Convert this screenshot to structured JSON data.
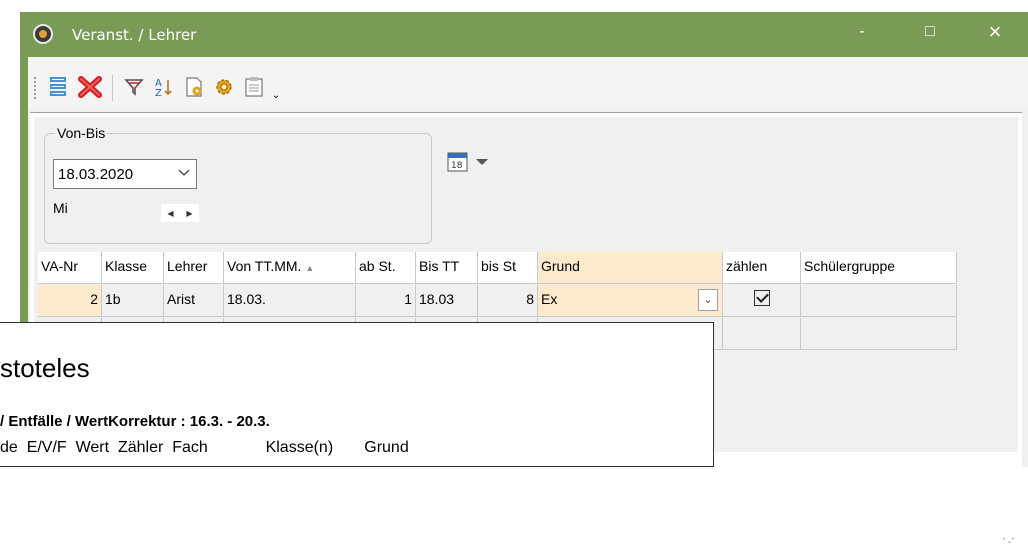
{
  "window": {
    "title": "Veranst. / Lehrer",
    "controls": {
      "minimize": "-",
      "maximize": "□",
      "close": "×"
    }
  },
  "toolbar": {
    "icons": [
      "list-icon",
      "delete-icon",
      "filter-icon",
      "sort-icon",
      "report-icon",
      "settings-icon",
      "clipboard-icon"
    ]
  },
  "filter": {
    "group_label": "Von-Bis",
    "date_value": "18.03.2020",
    "day": "Mi"
  },
  "grid": {
    "headers": [
      "VA-Nr",
      "Klasse",
      "Lehrer",
      "Von TT.MM.",
      "ab St.",
      "Bis TT",
      "bis St",
      "Grund",
      "zählen",
      "Schülergruppe"
    ],
    "rows": [
      {
        "va_nr": "2",
        "klasse": "1b",
        "lehrer": "Arist",
        "von": "18.03.",
        "ab_st": "1",
        "bis": "18.03",
        "bis_st": "8",
        "grund": "Ex",
        "zaehlen": true,
        "schuelergruppe": ""
      }
    ]
  },
  "popup": {
    "name": "stoteles",
    "subtitle": "/ Entfälle / WertKorrektur : 16.3. - 20.3.",
    "columns": "de  E/V/F  Wert  Zähler  Fach             Klasse(n)       Grund"
  },
  "colors": {
    "window_frame": "#7a9b56",
    "grund_highlight": "#fde9cc"
  }
}
